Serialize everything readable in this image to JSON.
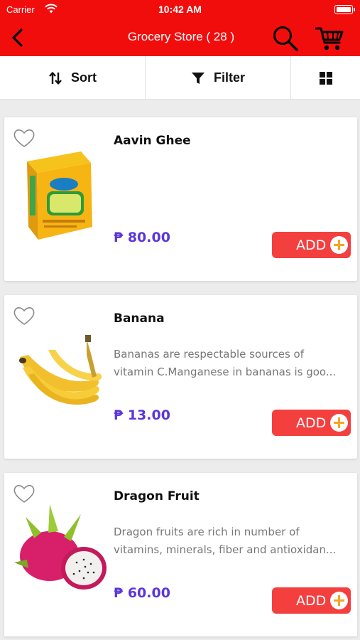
{
  "status_bar": {
    "carrier": "Carrier",
    "time": "10:42 AM"
  },
  "nav": {
    "title": "Grocery Store ( 28 )"
  },
  "toolbar": {
    "sort_label": "Sort",
    "filter_label": "Filter"
  },
  "currency_symbol": "₱",
  "products": [
    {
      "name": "Aavin Ghee",
      "desc_line1": "",
      "desc_line2": "",
      "price": "₱ 80.00",
      "add_label": "ADD"
    },
    {
      "name": "Banana",
      "desc_line1": "Bananas are respectable sources of",
      "desc_line2": "vitamin C.Manganese in bananas is goo...",
      "price": "₱ 13.00",
      "add_label": "ADD"
    },
    {
      "name": "Dragon Fruit",
      "desc_line1": "Dragon fruits are rich in number of",
      "desc_line2": "vitamins, minerals, fiber and antioxidan...",
      "price": "₱ 60.00",
      "add_label": "ADD"
    }
  ],
  "colors": {
    "header_red": "#f20d0d",
    "add_button": "#f43f3f",
    "price_purple": "#5b36d9",
    "plus_orange": "#f5a623"
  }
}
